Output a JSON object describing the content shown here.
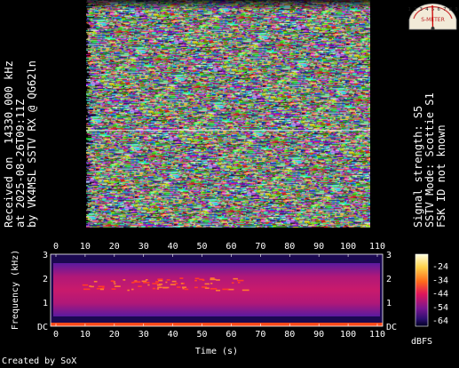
{
  "left_info": {
    "line1": "Received on  14330.000 kHz",
    "line2": "at 2025-08-26T09:11Z",
    "line3": "by VK4MSL SSTV RX @ QG62ln"
  },
  "right_info": {
    "line1": "Signal strength: S5",
    "line2": "SSTV Mode: Scottie S1",
    "line3": "FSK ID not known"
  },
  "meter": {
    "scale_top": "1 2 3 4 5 6 7 8 9",
    "scale_bottom": "S-METER",
    "reading": "S5"
  },
  "spectrogram": {
    "x_ticks": [
      "0",
      "10",
      "20",
      "30",
      "40",
      "50",
      "60",
      "70",
      "80",
      "90",
      "100",
      "110"
    ],
    "y_ticks": [
      "3",
      "2",
      "1",
      "DC"
    ],
    "x_label": "Time (s)",
    "y_label": "Frequency (kHz)",
    "colorbar_ticks": [
      "-24",
      "-34",
      "-44",
      "-54",
      "-64"
    ],
    "colorbar_label": "dBFS"
  },
  "footer": {
    "credit": "Created by SoX"
  }
}
